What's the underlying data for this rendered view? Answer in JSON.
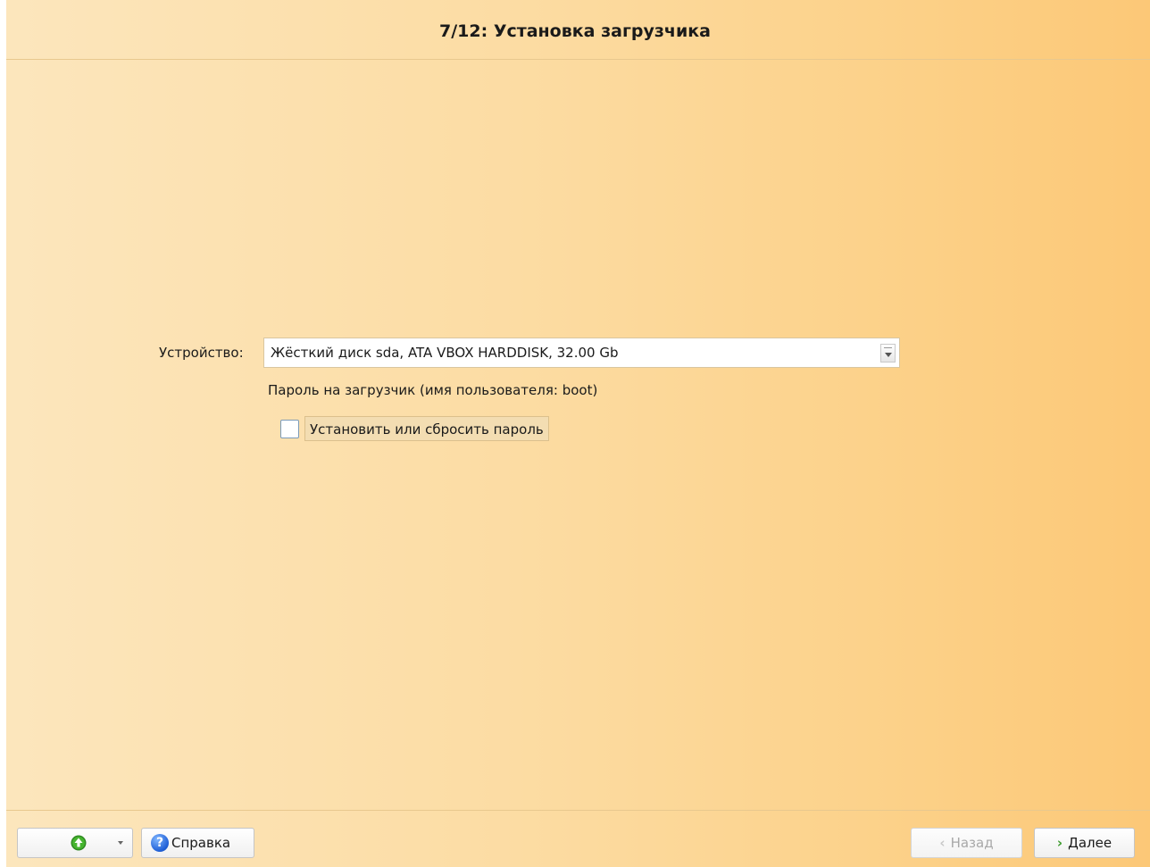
{
  "header": {
    "title": "7/12: Установка загрузчика"
  },
  "bootloader": {
    "device_label": "Устройство:",
    "device_value": "Жёсткий диск sda, ATA VBOX HARDDISK, 32.00 Gb",
    "password_caption": "Пароль на загрузчик (имя пользователя: boot)",
    "set_password_label": "Установить или сбросить пароль",
    "set_password_checked": false
  },
  "footer": {
    "menu_icon": "up-arrow-icon",
    "help_label": "Справка",
    "help_icon": "help-icon",
    "back_label": "Назад",
    "back_enabled": false,
    "next_label": "Далее"
  },
  "colors": {
    "background_left": "#fce6bd",
    "background_right": "#fcc877",
    "next_arrow": "#3a9a2a",
    "help_icon": "#1f5fd6"
  }
}
